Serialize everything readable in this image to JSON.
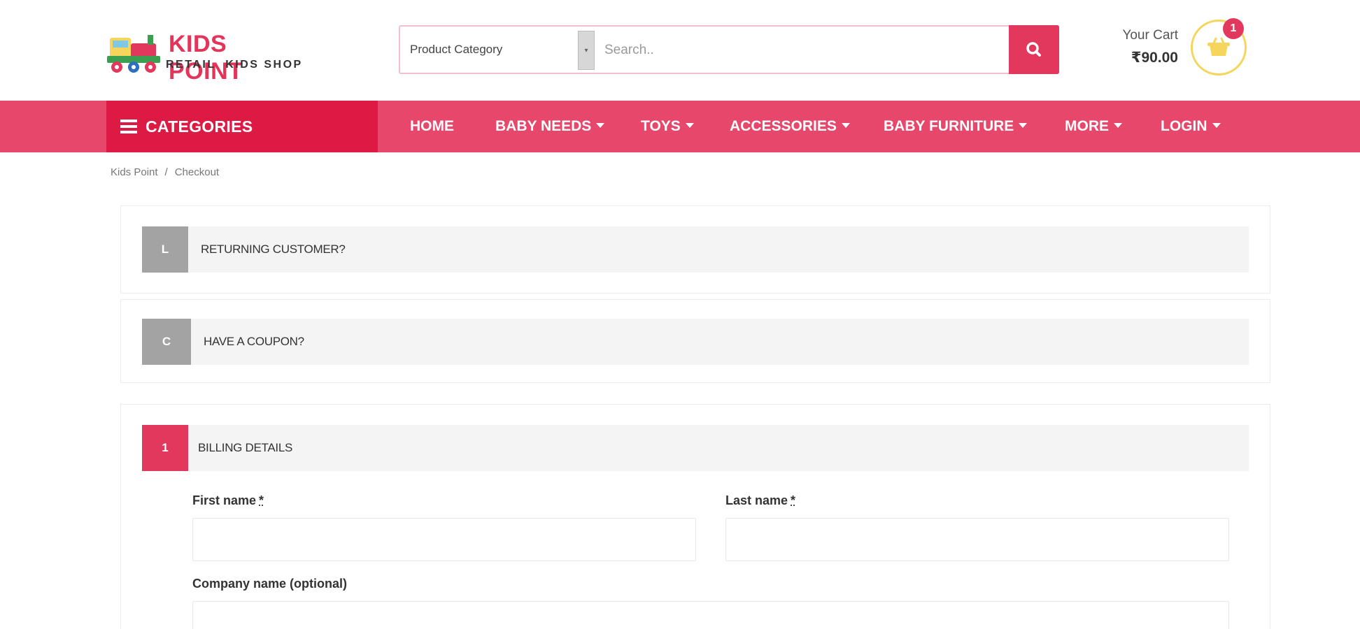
{
  "logo": {
    "title": "KIDS POINT",
    "subtitle": "RETAIL  KIDS SHOP"
  },
  "search": {
    "category": "Product Category",
    "placeholder": "Search.."
  },
  "cart": {
    "label": "Your Cart",
    "total": "₹90.00",
    "count": "1"
  },
  "categories_label": "CATEGORIES",
  "nav": [
    {
      "label": "HOME",
      "dropdown": false
    },
    {
      "label": "BABY NEEDS",
      "dropdown": true
    },
    {
      "label": "TOYS",
      "dropdown": true
    },
    {
      "label": "ACCESSORIES",
      "dropdown": true
    },
    {
      "label": "BABY FURNITURE",
      "dropdown": true
    },
    {
      "label": "MORE",
      "dropdown": true
    },
    {
      "label": "LOGIN",
      "dropdown": true
    }
  ],
  "breadcrumb": {
    "home": "Kids Point",
    "separator": "/",
    "current": "Checkout"
  },
  "sections": {
    "returning": {
      "badge": "L",
      "title": "RETURNING CUSTOMER?"
    },
    "coupon": {
      "badge": "C",
      "title": "HAVE A COUPON?"
    },
    "billing": {
      "badge": "1",
      "title": "BILLING DETAILS"
    }
  },
  "form": {
    "first_name": "First name",
    "last_name": "Last name",
    "required_mark": "*",
    "company": "Company name (optional)"
  },
  "colors": {
    "primary": "#e3385d",
    "nav": "#e6476a",
    "categories": "#dc1a44",
    "accent_yellow": "#f6d55c"
  }
}
